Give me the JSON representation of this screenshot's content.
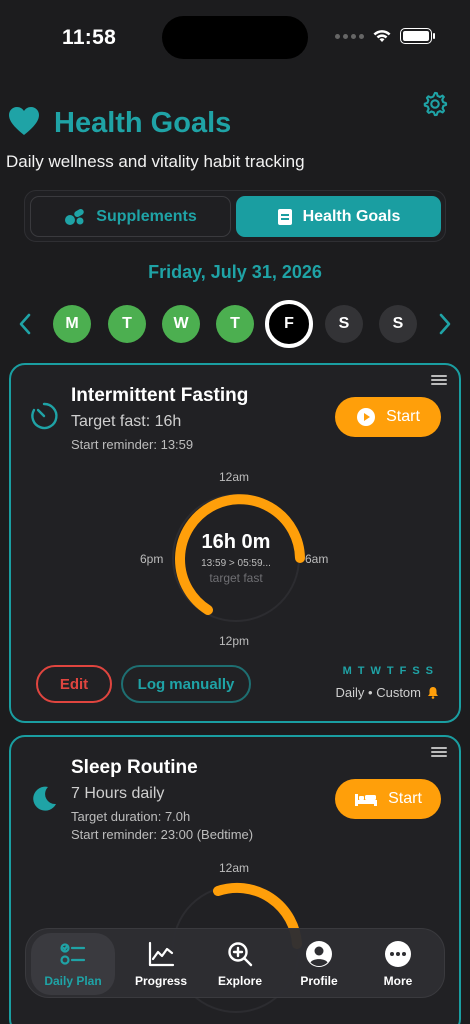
{
  "status": {
    "time": "11:58"
  },
  "header": {
    "title": "Health Goals",
    "subtitle": "Daily wellness and vitality habit tracking"
  },
  "segments": {
    "left": "Supplements",
    "right": "Health Goals",
    "selected": "right"
  },
  "date": "Friday, July 31, 2026",
  "week": {
    "days": [
      {
        "label": "M",
        "state": "done"
      },
      {
        "label": "T",
        "state": "done"
      },
      {
        "label": "W",
        "state": "done"
      },
      {
        "label": "T",
        "state": "done"
      },
      {
        "label": "F",
        "state": "today"
      },
      {
        "label": "S",
        "state": "future"
      },
      {
        "label": "S",
        "state": "future"
      }
    ]
  },
  "fasting": {
    "title": "Intermittent Fasting",
    "subtitle": "Target fast: 16h",
    "reminder": "Start reminder: 13:59",
    "start_label": "Start",
    "dial": {
      "top_label": "12am",
      "right_label": "6am",
      "bottom_label": "12pm",
      "left_label": "6pm",
      "duration": "16h 0m",
      "range": "13:59 > 05:59...",
      "caption": "target fast"
    },
    "edit_label": "Edit",
    "log_label": "Log manually",
    "weekdays": "MTWTFSS",
    "repeat": "Daily • Custom"
  },
  "sleep": {
    "title": "Sleep Routine",
    "subtitle": "7 Hours daily",
    "target": "Target duration: 7.0h",
    "reminder": "Start reminder: 23:00 (Bedtime)",
    "start_label": "Start",
    "dial": {
      "top_label": "12am"
    }
  },
  "tabs": [
    {
      "label": "Daily Plan",
      "icon": "checklist-icon",
      "active": true
    },
    {
      "label": "Progress",
      "icon": "chart-icon",
      "active": false
    },
    {
      "label": "Explore",
      "icon": "search-icon",
      "active": false
    },
    {
      "label": "Profile",
      "icon": "person-icon",
      "active": false
    },
    {
      "label": "More",
      "icon": "more-icon",
      "active": false
    }
  ],
  "colors": {
    "accent": "#1fa3a6",
    "orange": "#ff9f0a",
    "green": "#4caf50",
    "danger": "#e0453f"
  }
}
